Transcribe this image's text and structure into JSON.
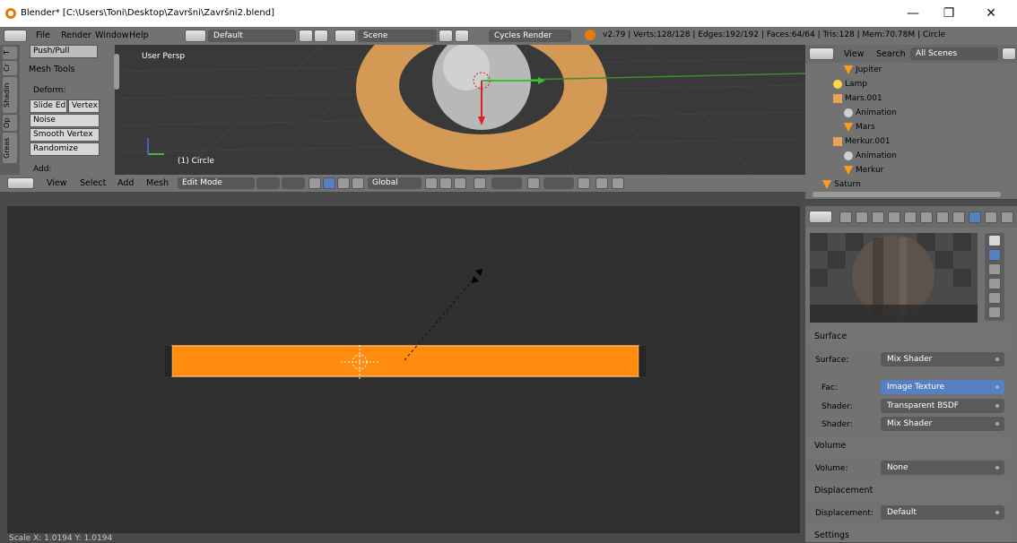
{
  "window": {
    "title": "Blender* [C:\\Users\\Toni\\Desktop\\Završni\\Završni2.blend]",
    "minimize": "—",
    "maximize": "❐",
    "close": "✕"
  },
  "menubar": {
    "items": [
      "File",
      "Render",
      "Window",
      "Help"
    ],
    "layout": "Default",
    "scene": "Scene",
    "engine": "Cycles Render",
    "stats": "v2.79 | Verts:128/128 | Edges:192/192 | Faces:64/64 | Tris:128 | Mem:70.78M | Circle"
  },
  "toolshelf": {
    "tabs": [
      "T",
      "Cr",
      "Shadin",
      "Op",
      "Greas"
    ],
    "top_button": "Push/Pull",
    "panel_title": "Mesh Tools",
    "deform_label": "Deform:",
    "buttons": [
      "Slide Ed",
      "Vertex",
      "Noise",
      "Smooth Vertex",
      "Randomize"
    ],
    "add_label": "Add:"
  },
  "viewport": {
    "label": "User Persp",
    "object": "(1) Circle"
  },
  "viewport_header": {
    "menus": [
      "View",
      "Select",
      "Add",
      "Mesh"
    ],
    "mode": "Edit Mode",
    "orientation": "Global"
  },
  "uv_viewport": {
    "status": "Scale X: 1.0194  Y: 1.0194"
  },
  "outliner": {
    "menus": [
      "View",
      "Search"
    ],
    "filter": "All Scenes",
    "rows": [
      {
        "name": "Jupiter",
        "indent": 2,
        "type": "mesh"
      },
      {
        "name": "Lamp",
        "indent": 1,
        "type": "lamp"
      },
      {
        "name": "Mars.001",
        "indent": 1,
        "type": "empty"
      },
      {
        "name": "Animation",
        "indent": 2,
        "type": "anim"
      },
      {
        "name": "Mars",
        "indent": 2,
        "type": "mesh"
      },
      {
        "name": "Merkur.001",
        "indent": 1,
        "type": "empty"
      },
      {
        "name": "Animation",
        "indent": 2,
        "type": "anim"
      },
      {
        "name": "Merkur",
        "indent": 2,
        "type": "mesh"
      },
      {
        "name": "Saturn",
        "indent": 1,
        "type": "mesh"
      }
    ]
  },
  "properties": {
    "surface_section": "Surface",
    "surface_label": "Surface:",
    "surface_value": "Mix Shader",
    "fac_label": "Fac:",
    "fac_value": "Image Texture",
    "shader1_label": "Shader:",
    "shader1_value": "Transparent BSDF",
    "shader2_label": "Shader:",
    "shader2_value": "Mix Shader",
    "volume_section": "Volume",
    "volume_label": "Volume:",
    "volume_value": "None",
    "displacement_section": "Displacement",
    "displacement_label": "Displacement:",
    "displacement_value": "Default",
    "settings_section": "Settings"
  },
  "colors": {
    "accent_orange": "#ff8c0f",
    "selection_blue": "#5680c2"
  }
}
